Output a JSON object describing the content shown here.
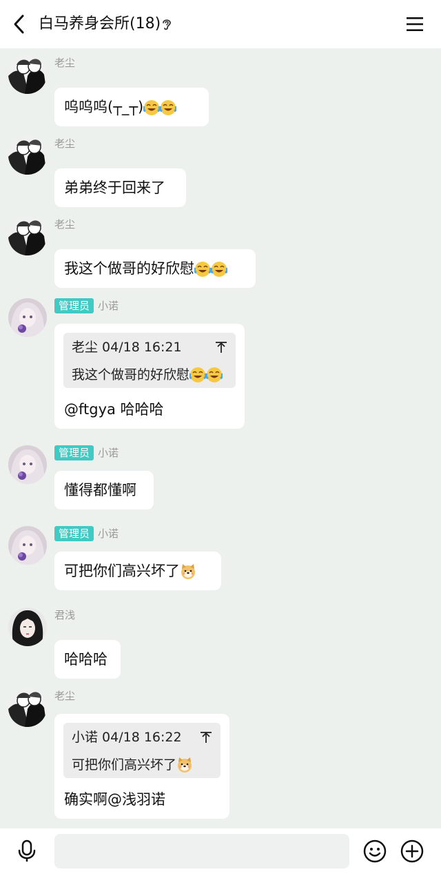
{
  "header": {
    "title": "白马养身会所(18)",
    "back_icon": "chevron-left-icon",
    "ear_icon": "ear-icon",
    "menu_icon": "hamburger-menu-icon"
  },
  "messages": [
    {
      "sender": "老尘",
      "text": "呜呜呜(┬_┬)",
      "emojis": [
        "cry-laugh",
        "cry-laugh"
      ]
    },
    {
      "sender": "老尘",
      "text": "弟弟终于回来了"
    },
    {
      "sender": "老尘",
      "text": "我这个做哥的好欣慰",
      "emojis": [
        "cry-laugh",
        "cry-laugh"
      ]
    },
    {
      "sender": "小诺",
      "badge": "管理员",
      "quote": {
        "author_time": "老尘 04/18 16:21",
        "text": "我这个做哥的好欣慰",
        "emojis": [
          "cry-laugh",
          "cry-laugh"
        ]
      },
      "text": "@ftgya 哈哈哈"
    },
    {
      "sender": "小诺",
      "badge": "管理员",
      "text": "懂得都懂啊"
    },
    {
      "sender": "小诺",
      "badge": "管理员",
      "text": "可把你们高兴坏了",
      "emojis": [
        "doge"
      ]
    },
    {
      "sender": "君浅",
      "text": "哈哈哈"
    },
    {
      "sender": "老尘",
      "quote": {
        "author_time": "小诺 04/18 16:22",
        "text": "可把你们高兴坏了",
        "emojis": [
          "doge"
        ]
      },
      "text": "确实啊@浅羽诺"
    }
  ],
  "footer": {
    "input_value": "",
    "mic_icon": "microphone-icon",
    "emoji_icon": "smiley-icon",
    "plus_icon": "plus-circle-icon"
  },
  "colors": {
    "background": "#edf1ee",
    "bubble": "#ffffff",
    "admin_badge": "#41c9c4",
    "sender_name": "#999999",
    "quote_bg": "#ececec"
  }
}
